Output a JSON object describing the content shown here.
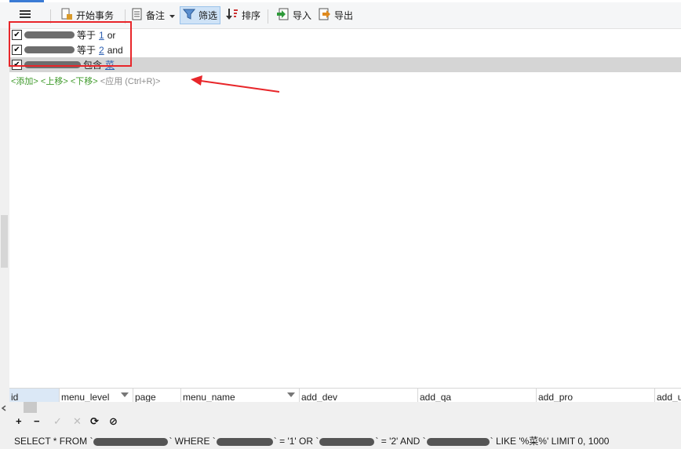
{
  "toolbar": {
    "menu_icon": "hamburger-menu-icon",
    "begin_transaction": "开始事务",
    "notes": "备注",
    "filter": "筛选",
    "sort": "排序",
    "import": "导入",
    "export": "导出"
  },
  "filters": [
    {
      "operator": "等于",
      "value": "1",
      "logic": "or",
      "checked": true
    },
    {
      "operator": "等于",
      "value": "2",
      "logic": "and",
      "checked": true
    },
    {
      "operator": "包含",
      "value": "菜",
      "logic": "",
      "checked": true
    }
  ],
  "filter_actions": {
    "add": "<添加>",
    "move_up": "<上移>",
    "move_down": "<下移>",
    "apply": "<应用 (Ctrl+R)>"
  },
  "columns": [
    "id",
    "menu_level",
    "page",
    "menu_name",
    "add_dev",
    "add_qa",
    "add_pro",
    "add_u"
  ],
  "bottom_toolbar": {
    "add": "+",
    "delete": "−",
    "confirm": "✓",
    "cancel": "✕",
    "refresh": "⟳",
    "stop": "⊘"
  },
  "sql": {
    "p1": "SELECT * FROM `",
    "p2": "` WHERE `",
    "p3": "` = '1' OR `",
    "p4": "` = '2' AND `",
    "p5": "` LIKE '%菜%' LIMIT 0, 1000"
  },
  "colors": {
    "highlight_red": "#e8262a",
    "action_green": "#3e9a2a",
    "link_blue": "#2a5db0",
    "filter_active_bg": "#cfe3f7"
  }
}
